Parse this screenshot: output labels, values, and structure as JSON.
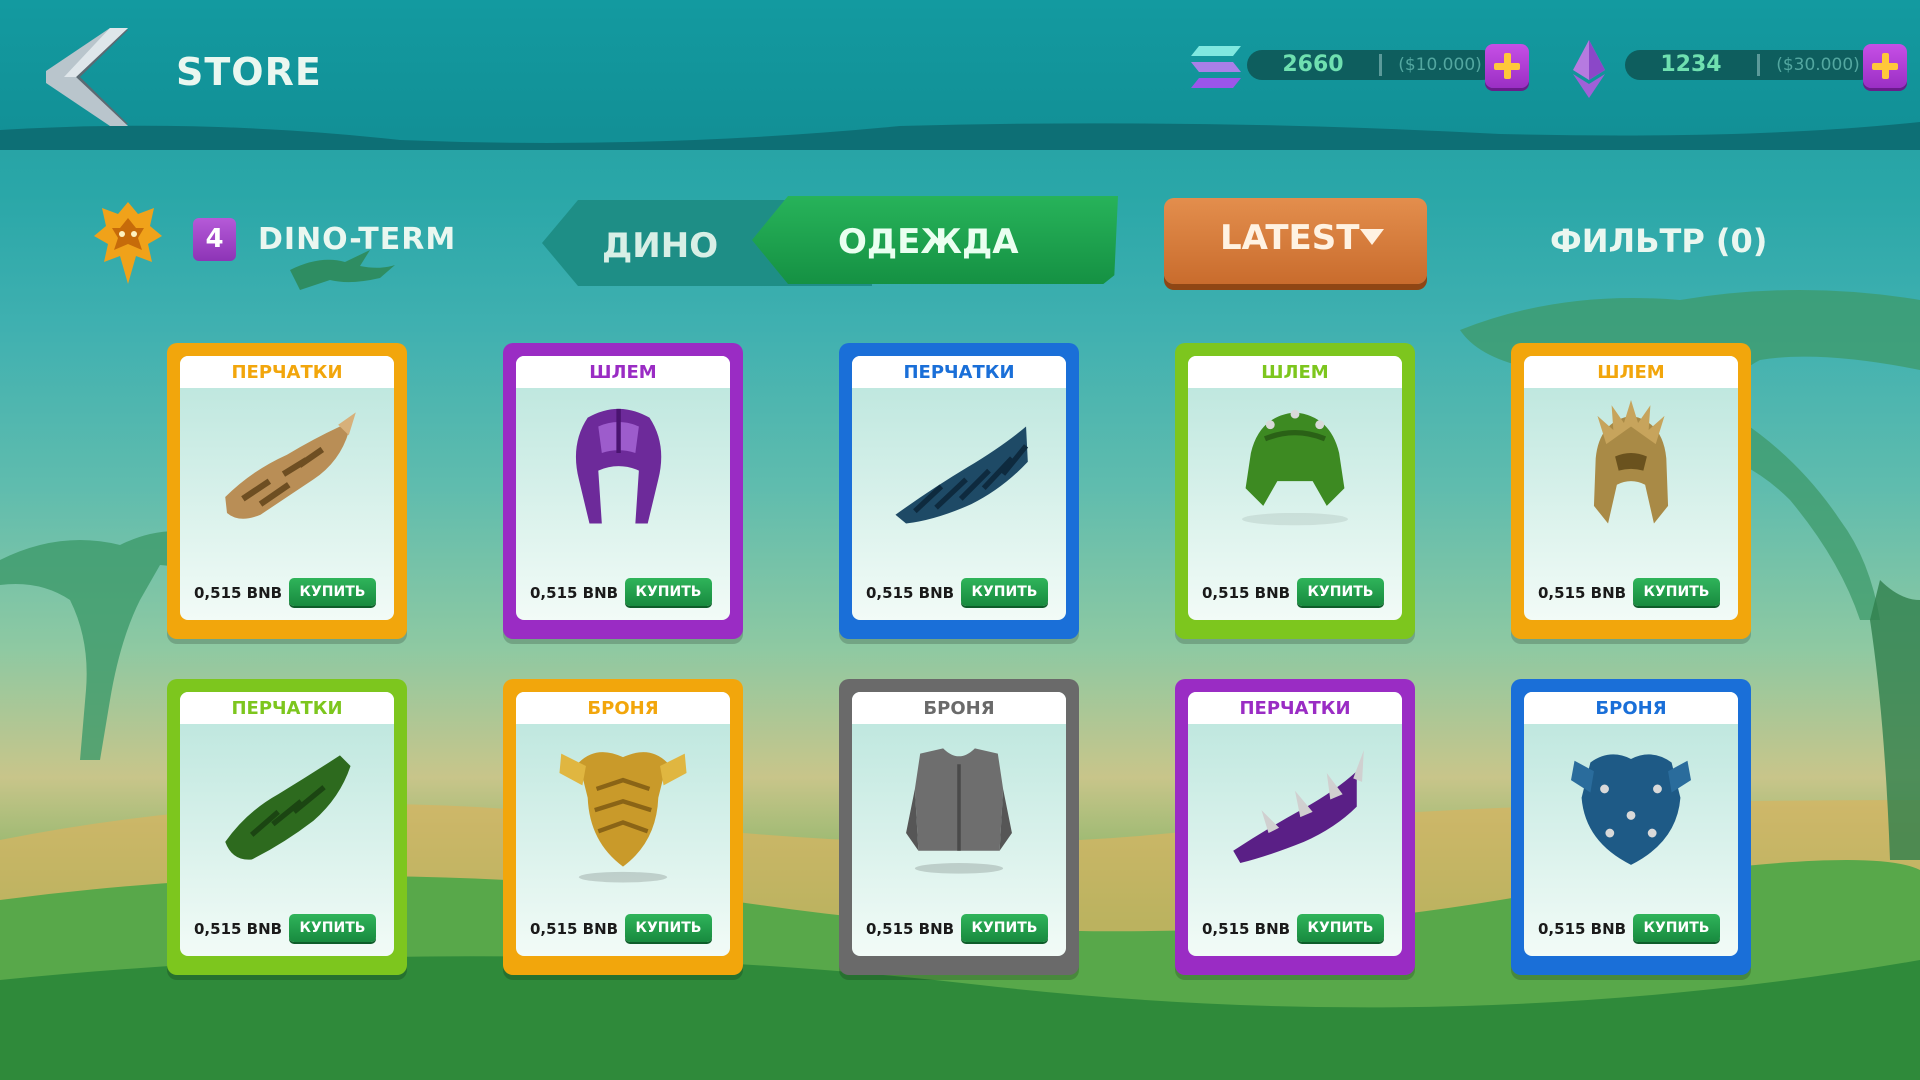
{
  "header": {
    "title": "STORE",
    "back_icon": "back-arrow-icon"
  },
  "currencies": [
    {
      "name": "Solana",
      "icon": "solana-icon",
      "amount": "2660",
      "usd": "($10.000)"
    },
    {
      "name": "Ethereum",
      "icon": "ethereum-icon",
      "amount": "1234",
      "usd": "($30.000)"
    }
  ],
  "player": {
    "level": "4",
    "name": "DINO-TERM"
  },
  "tabs": [
    {
      "label": "ДИНО",
      "active": false
    },
    {
      "label": "ОДЕЖДА",
      "active": true
    }
  ],
  "sort": {
    "label": "LATEST"
  },
  "filter": {
    "label": "ФИЛЬТР (0)"
  },
  "colors": {
    "orange": "#f2a60c",
    "purple": "#9a2cc4",
    "blue": "#1a6fd8",
    "green": "#7dc61e",
    "gray": "#6a6a6a"
  },
  "items": [
    {
      "category": "ПЕРЧАТКИ",
      "frame": "orange",
      "art": "gold-gauntlet",
      "price": "0,515 BNB",
      "buy": "КУПИТЬ"
    },
    {
      "category": "ШЛЕМ",
      "frame": "purple",
      "art": "purple-helmet",
      "price": "0,515 BNB",
      "buy": "КУПИТЬ"
    },
    {
      "category": "ПЕРЧАТКИ",
      "frame": "blue",
      "art": "blue-gauntlet",
      "price": "0,515 BNB",
      "buy": "КУПИТЬ"
    },
    {
      "category": "ШЛЕМ",
      "frame": "green",
      "art": "green-helmet",
      "price": "0,515 BNB",
      "buy": "КУПИТЬ"
    },
    {
      "category": "ШЛЕМ",
      "frame": "orange",
      "art": "gold-helmet",
      "price": "0,515 BNB",
      "buy": "КУПИТЬ"
    },
    {
      "category": "ПЕРЧАТКИ",
      "frame": "green",
      "art": "green-gauntlet",
      "price": "0,515 BNB",
      "buy": "КУПИТЬ"
    },
    {
      "category": "БРОНЯ",
      "frame": "orange",
      "art": "gold-armor",
      "price": "0,515 BNB",
      "buy": "КУПИТЬ"
    },
    {
      "category": "БРОНЯ",
      "frame": "gray",
      "art": "gray-vest",
      "price": "0,515 BNB",
      "buy": "КУПИТЬ"
    },
    {
      "category": "ПЕРЧАТКИ",
      "frame": "purple",
      "art": "purple-spiked-gauntlet",
      "price": "0,515 BNB",
      "buy": "КУПИТЬ"
    },
    {
      "category": "БРОНЯ",
      "frame": "blue",
      "art": "blue-spiked-armor",
      "price": "0,515 BNB",
      "buy": "КУПИТЬ"
    }
  ]
}
